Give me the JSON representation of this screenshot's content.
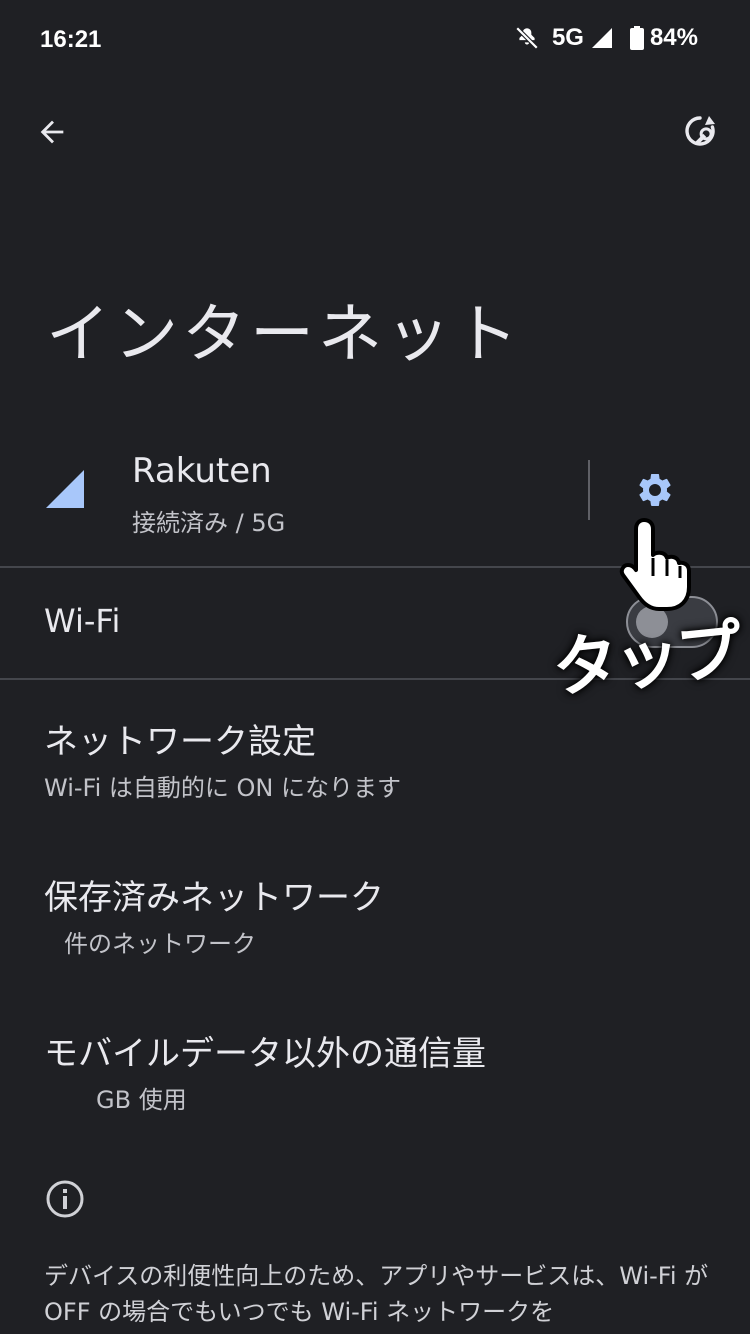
{
  "status_bar": {
    "time": "16:21",
    "network": "5G",
    "battery": "84%",
    "icons": [
      "mute-icon",
      "signal-icon",
      "battery-icon"
    ]
  },
  "toolbar": {
    "back_icon": "arrow-left-icon",
    "reset_icon": "network-reset-icon"
  },
  "page": {
    "title": "インターネット"
  },
  "carrier": {
    "name": "Rakuten",
    "status": "接続済み / 5G",
    "settings_icon": "gear-icon",
    "accent_color": "#a8c7fa"
  },
  "wifi": {
    "label": "Wi-Fi",
    "enabled": false
  },
  "items": [
    {
      "title": "ネットワーク設定",
      "summary": "Wi-Fi は自動的に ON になります"
    },
    {
      "title": "保存済みネットワーク",
      "summary": "件のネットワーク"
    },
    {
      "title": "モバイルデータ以外の通信量",
      "summary": "GB 使用"
    }
  ],
  "footer": {
    "info_icon": "info-icon",
    "text": "デバイスの利便性向上のため、アプリやサービスは、Wi-Fi が OFF の場合でもいつでも Wi-Fi ネットワークを"
  },
  "annotation": {
    "label": "タップ",
    "icon": "pointing-hand-icon"
  }
}
